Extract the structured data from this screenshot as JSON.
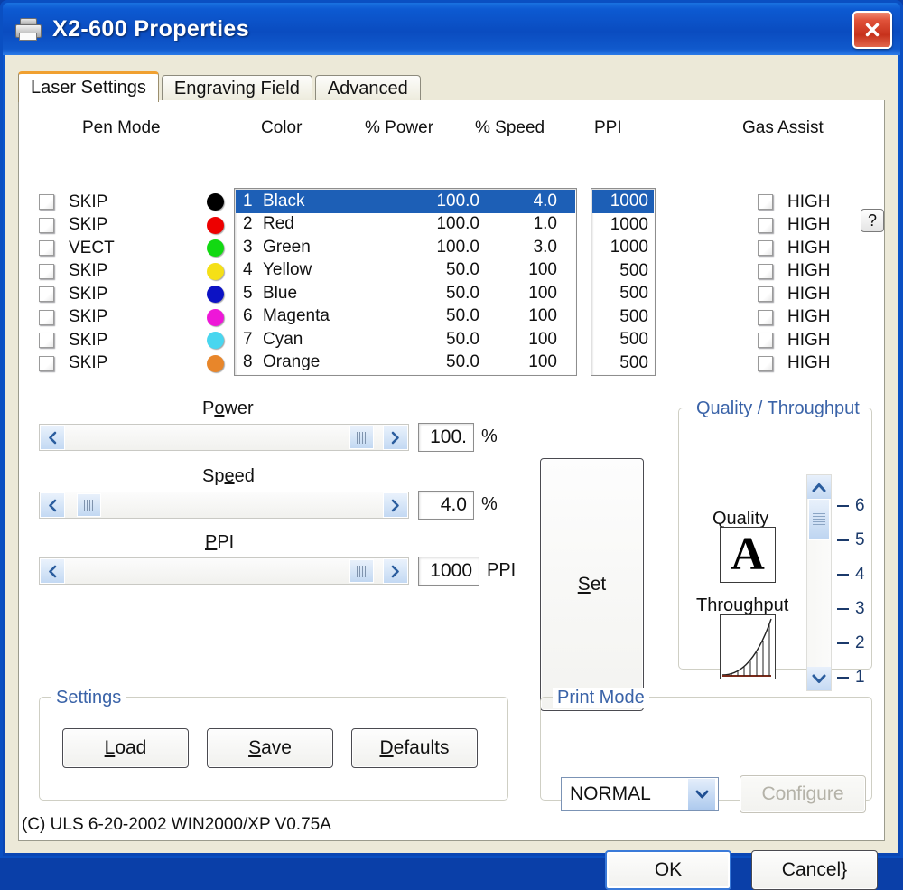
{
  "window": {
    "title": "X2-600 Properties",
    "icon": "printer-icon",
    "close_label": "close-icon",
    "titlebar_color": "#0a4cc0",
    "client_color": "#ece9d8"
  },
  "tabs": [
    {
      "label": "Laser Settings",
      "active": true
    },
    {
      "label": "Engraving Field",
      "active": false
    },
    {
      "label": "Advanced",
      "active": false
    }
  ],
  "columns": {
    "pen_mode": "Pen Mode",
    "color": "Color",
    "power": "% Power",
    "speed": "% Speed",
    "ppi": "PPI",
    "gas_assist": "Gas Assist",
    "help": "?"
  },
  "pens": [
    {
      "index": "1",
      "name": "Black",
      "power": "100.0",
      "speed": "4.0",
      "ppi": "1000",
      "mode": "SKIP",
      "gas": "HIGH",
      "swatch": "#000000",
      "selected": true,
      "mode_checked": false,
      "gas_checked": false
    },
    {
      "index": "2",
      "name": "Red",
      "power": "100.0",
      "speed": "1.0",
      "ppi": "1000",
      "mode": "SKIP",
      "gas": "HIGH",
      "swatch": "#ed0000",
      "selected": false,
      "mode_checked": false,
      "gas_checked": false
    },
    {
      "index": "3",
      "name": "Green",
      "power": "100.0",
      "speed": "3.0",
      "ppi": "1000",
      "mode": "VECT",
      "gas": "HIGH",
      "swatch": "#12d912",
      "selected": false,
      "mode_checked": false,
      "gas_checked": false
    },
    {
      "index": "4",
      "name": "Yellow",
      "power": "50.0",
      "speed": "100",
      "ppi": "500",
      "mode": "SKIP",
      "gas": "HIGH",
      "swatch": "#f5e017",
      "selected": false,
      "mode_checked": false,
      "gas_checked": false
    },
    {
      "index": "5",
      "name": "Blue",
      "power": "50.0",
      "speed": "100",
      "ppi": "500",
      "mode": "SKIP",
      "gas": "HIGH",
      "swatch": "#0c12c4",
      "selected": false,
      "mode_checked": false,
      "gas_checked": false
    },
    {
      "index": "6",
      "name": "Magenta",
      "power": "50.0",
      "speed": "100",
      "ppi": "500",
      "mode": "SKIP",
      "gas": "HIGH",
      "swatch": "#ee17d8",
      "selected": false,
      "mode_checked": false,
      "gas_checked": false
    },
    {
      "index": "7",
      "name": "Cyan",
      "power": "50.0",
      "speed": "100",
      "ppi": "500",
      "mode": "SKIP",
      "gas": "HIGH",
      "swatch": "#49d6ef",
      "selected": false,
      "mode_checked": false,
      "gas_checked": false
    },
    {
      "index": "8",
      "name": "Orange",
      "power": "50.0",
      "speed": "100",
      "ppi": "500",
      "mode": "SKIP",
      "gas": "HIGH",
      "swatch": "#e8862a",
      "selected": false,
      "mode_checked": false,
      "gas_checked": false
    }
  ],
  "sliders": {
    "power": {
      "caption_pre": "P",
      "caption_mn": "o",
      "caption_post": "wer",
      "value": "100.",
      "unit": "%",
      "fill_percent": 97
    },
    "speed": {
      "caption_pre": "Sp",
      "caption_mn": "e",
      "caption_post": "ed",
      "value": "4.0",
      "unit": "%",
      "fill_percent": 4
    },
    "ppi": {
      "caption_pre": "",
      "caption_mn": "P",
      "caption_post": "PI",
      "value": "1000",
      "unit": "PPI",
      "fill_percent": 97
    }
  },
  "set_button": {
    "pre": "",
    "mn": "S",
    "post": "et"
  },
  "quality_throughput": {
    "title": "Quality / Throughput",
    "quality_label": "Quality",
    "quality_glyph": "A",
    "throughput_label": "Throughput",
    "ticks": [
      "6",
      "5",
      "4",
      "3",
      "2",
      "1"
    ],
    "value": 6
  },
  "settings_group": {
    "title": "Settings",
    "buttons": [
      {
        "pre": "",
        "mn": "L",
        "post": "oad",
        "name": "load-button",
        "disabled": false
      },
      {
        "pre": "",
        "mn": "S",
        "post": "ave",
        "name": "save-button",
        "disabled": false
      },
      {
        "pre": "",
        "mn": "D",
        "post": "efaults",
        "name": "defaults-button",
        "disabled": false
      }
    ]
  },
  "print_mode": {
    "title": "Print Mode",
    "selected": "NORMAL",
    "options": [
      "NORMAL"
    ],
    "configure_label": "Configure",
    "configure_disabled": true
  },
  "copyright": "(C) ULS 6-20-2002 WIN2000/XP V0.75A",
  "footer_buttons": {
    "ok": "OK",
    "cancel": "Cancel"
  }
}
